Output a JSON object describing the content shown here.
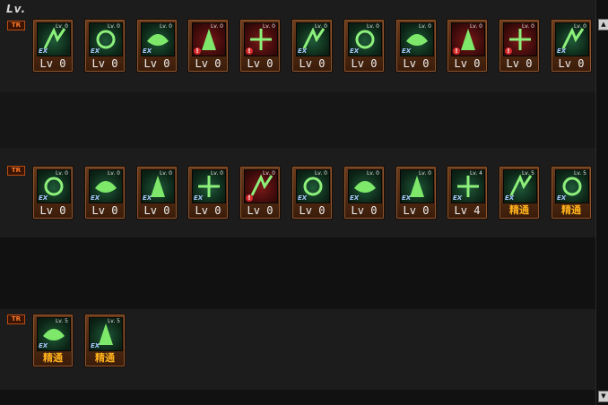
{
  "header": {
    "lv_label": "Lv."
  },
  "rows": [
    {
      "tag": "TR",
      "skills": [
        {
          "level": "Lv. 0",
          "caption": "Lv 0",
          "badge": "EX",
          "red": false
        },
        {
          "level": "Lv. 0",
          "caption": "Lv 0",
          "badge": "EX",
          "red": false
        },
        {
          "level": "Lv. 0",
          "caption": "Lv 0",
          "badge": "EX",
          "red": false
        },
        {
          "level": "Lv. 0",
          "caption": "Lv 0",
          "badge": "!",
          "red": true
        },
        {
          "level": "Lv. 0",
          "caption": "Lv 0",
          "badge": "!",
          "red": true
        },
        {
          "level": "Lv. 0",
          "caption": "Lv 0",
          "badge": "EX",
          "red": false
        },
        {
          "level": "Lv. 0",
          "caption": "Lv 0",
          "badge": "EX",
          "red": false
        },
        {
          "level": "Lv. 0",
          "caption": "Lv 0",
          "badge": "EX",
          "red": false
        },
        {
          "level": "Lv. 0",
          "caption": "Lv 0",
          "badge": "!",
          "red": true
        },
        {
          "level": "Lv. 0",
          "caption": "Lv 0",
          "badge": "!",
          "red": true
        },
        {
          "level": "Lv. 0",
          "caption": "Lv 0",
          "badge": "EX",
          "red": false
        }
      ]
    },
    {
      "tag": "TR",
      "skills": [
        {
          "level": "Lv. 0",
          "caption": "Lv 0",
          "badge": "EX",
          "red": false
        },
        {
          "level": "Lv. 0",
          "caption": "Lv 0",
          "badge": "EX",
          "red": false
        },
        {
          "level": "Lv. 0",
          "caption": "Lv 0",
          "badge": "EX",
          "red": false
        },
        {
          "level": "Lv. 0",
          "caption": "Lv 0",
          "badge": "EX",
          "red": false
        },
        {
          "level": "Lv. 0",
          "caption": "Lv 0",
          "badge": "!",
          "red": true
        },
        {
          "level": "Lv. 0",
          "caption": "Lv 0",
          "badge": "EX",
          "red": false
        },
        {
          "level": "Lv. 0",
          "caption": "Lv 0",
          "badge": "EX",
          "red": false
        },
        {
          "level": "Lv. 0",
          "caption": "Lv 0",
          "badge": "EX",
          "red": false
        },
        {
          "level": "Lv. 4",
          "caption": "Lv 4",
          "badge": "EX",
          "red": false
        },
        {
          "level": "Lv. 5",
          "caption": "精通",
          "badge": "EX",
          "red": false,
          "master": true
        },
        {
          "level": "Lv. 5",
          "caption": "精通",
          "badge": "EX",
          "red": false,
          "master": true
        }
      ]
    },
    {
      "tag": "TR",
      "skills": [
        {
          "level": "Lv. 5",
          "caption": "精通",
          "badge": "EX",
          "red": false,
          "master": true
        },
        {
          "level": "Lv. 5",
          "caption": "精通",
          "badge": "EX",
          "red": false,
          "master": true
        }
      ]
    }
  ],
  "colors": {
    "icon_green": "#1f5a38",
    "icon_red": "#7a1818",
    "frame_brown": "#6b3b1b",
    "master_gold": "#ffb21c"
  },
  "scrollbar": {
    "up_icon": "▲",
    "down_icon": "▼"
  }
}
